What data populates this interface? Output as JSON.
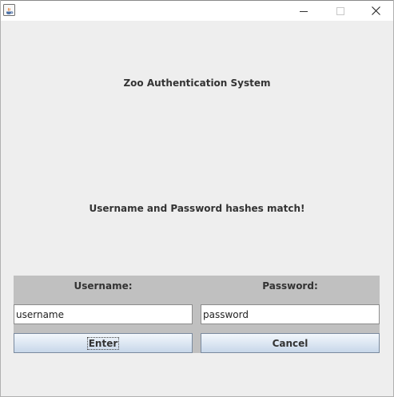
{
  "window": {
    "title": "",
    "controls": {
      "minimize": "minimize-icon",
      "maximize": "maximize-icon",
      "close": "close-icon"
    }
  },
  "main": {
    "title": "Zoo Authentication System",
    "status_message": "Username and Password hashes match!"
  },
  "form": {
    "username_label": "Username:",
    "password_label": "Password:",
    "username_value": "username",
    "password_value": "password",
    "enter_label": "Enter",
    "cancel_label": "Cancel"
  },
  "colors": {
    "background": "#eeeeee",
    "form_panel": "#c0c0c0",
    "button_gradient_top": "#f3f7fc",
    "button_gradient_bottom": "#c8d7e9"
  }
}
